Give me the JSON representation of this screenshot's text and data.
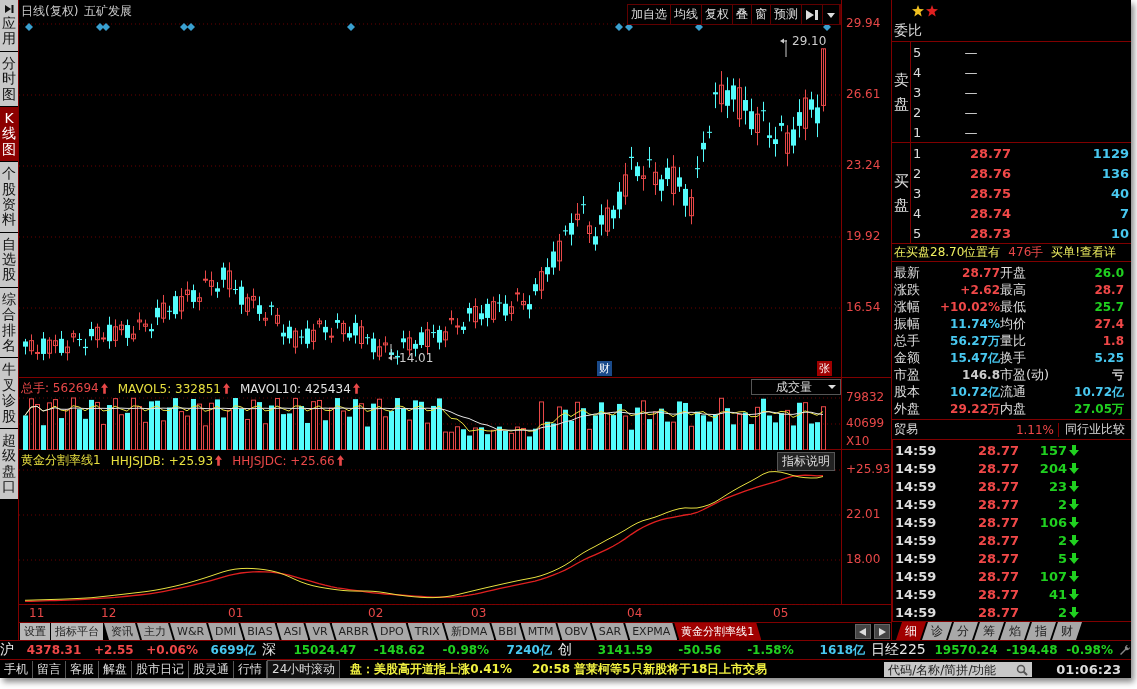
{
  "sidebar": [
    {
      "label": "应用",
      "kind": "app",
      "selected": false
    },
    {
      "label": "分时图",
      "kind": "view",
      "selected": false
    },
    {
      "label": "K线图",
      "kind": "view",
      "selected": true
    },
    {
      "label": "个股资料",
      "kind": "view",
      "selected": false
    },
    {
      "label": "自选股",
      "kind": "view",
      "selected": false
    },
    {
      "label": "综合排名",
      "kind": "view",
      "selected": false
    },
    {
      "label": "牛叉诊股",
      "kind": "view",
      "selected": false
    },
    {
      "label": "超级盘口",
      "kind": "view",
      "selected": false
    }
  ],
  "chart": {
    "title": "日线(复权)",
    "stock": "五矿发展",
    "toolbar": [
      "加自选",
      "均线",
      "复权",
      "叠",
      "窗",
      "预测"
    ],
    "price_axis": [
      "29.94",
      "26.61",
      "23.24",
      "19.92",
      "16.54"
    ],
    "high_mark": "29.10",
    "low_mark": "14.01",
    "badges": [
      {
        "text": "财",
        "kind": "finance"
      },
      {
        "text": "张",
        "kind": "limit"
      }
    ]
  },
  "volume": {
    "legend": [
      {
        "text": "总手: 562694",
        "color": "#e84848"
      },
      {
        "text": "MAVOL5: 332851",
        "color": "#e8e040"
      },
      {
        "text": "MAVOL10: 425434",
        "color": "#e4e4e4"
      }
    ],
    "selector": "成交量",
    "axis": [
      "79832",
      "40699",
      "X10"
    ]
  },
  "indicator": {
    "name": "黄金分割率线1",
    "legend": [
      {
        "text": "HHJSJDB: +25.93",
        "color": "#e8e040"
      },
      {
        "text": "HHJSJDC: +25.66",
        "color": "#e84848"
      }
    ],
    "help": "指标说明",
    "axis": [
      "+25.93",
      "22.01",
      "18.00"
    ]
  },
  "x_axis": [
    "11",
    "12",
    "01",
    "02",
    "03",
    "04",
    "05"
  ],
  "indicator_tabs": [
    {
      "label": "设置",
      "kind": "button",
      "selected": false
    },
    {
      "label": "指标平台",
      "kind": "button",
      "selected": false
    },
    {
      "label": "资讯",
      "kind": "tab",
      "selected": false
    },
    {
      "label": "主力",
      "kind": "tab",
      "selected": false
    },
    {
      "label": "W&R",
      "kind": "tab",
      "selected": false
    },
    {
      "label": "DMI",
      "kind": "tab",
      "selected": false
    },
    {
      "label": "BIAS",
      "kind": "tab",
      "selected": false
    },
    {
      "label": "ASI",
      "kind": "tab",
      "selected": false
    },
    {
      "label": "VR",
      "kind": "tab",
      "selected": false
    },
    {
      "label": "ARBR",
      "kind": "tab",
      "selected": false
    },
    {
      "label": "DPO",
      "kind": "tab",
      "selected": false
    },
    {
      "label": "TRIX",
      "kind": "tab",
      "selected": false
    },
    {
      "label": "新DMA",
      "kind": "tab",
      "selected": false
    },
    {
      "label": "BBI",
      "kind": "tab",
      "selected": false
    },
    {
      "label": "MTM",
      "kind": "tab",
      "selected": false
    },
    {
      "label": "OBV",
      "kind": "tab",
      "selected": false
    },
    {
      "label": "SAR",
      "kind": "tab",
      "selected": false
    },
    {
      "label": "EXPMA",
      "kind": "tab",
      "selected": false
    },
    {
      "label": "黄金分割率线1",
      "kind": "tab",
      "selected": true
    }
  ],
  "order_book": {
    "title": "委比",
    "sell_label": "卖盘",
    "buy_label": "买盘",
    "sell": [
      {
        "rank": "5",
        "price": "—"
      },
      {
        "rank": "4",
        "price": "—"
      },
      {
        "rank": "3",
        "price": "—"
      },
      {
        "rank": "2",
        "price": "—"
      },
      {
        "rank": "1",
        "price": "—"
      }
    ],
    "buy": [
      {
        "rank": "1",
        "price": "28.77",
        "volume": "1129"
      },
      {
        "rank": "2",
        "price": "28.76",
        "volume": "136"
      },
      {
        "rank": "3",
        "price": "28.75",
        "volume": "40"
      },
      {
        "rank": "4",
        "price": "28.74",
        "volume": "7"
      },
      {
        "rank": "5",
        "price": "28.73",
        "volume": "10"
      }
    ]
  },
  "notice": {
    "text": "在买盘28.70位置有",
    "qty": "476手",
    "link": "买单!查看详"
  },
  "stats": [
    [
      {
        "label": "最新",
        "value": "28.77",
        "color": "#f04848"
      },
      {
        "label": "开盘",
        "value": "26.0",
        "color": "#20d020"
      }
    ],
    [
      {
        "label": "涨跌",
        "value": "+2.62",
        "color": "#f04848"
      },
      {
        "label": "最高",
        "value": "28.7",
        "color": "#f04848"
      }
    ],
    [
      {
        "label": "涨幅",
        "value": "+10.02%",
        "color": "#f04848"
      },
      {
        "label": "最低",
        "value": "25.7",
        "color": "#20d020"
      }
    ],
    [
      {
        "label": "振幅",
        "value": "11.74%",
        "color": "#48c8f0"
      },
      {
        "label": "均价",
        "value": "27.4",
        "color": "#f04848"
      }
    ],
    [
      {
        "label": "总手",
        "value": "56.27万",
        "color": "#48c8f0"
      },
      {
        "label": "量比",
        "value": "1.8",
        "color": "#f04848"
      }
    ],
    [
      {
        "label": "金额",
        "value": "15.47亿",
        "color": "#48c8f0"
      },
      {
        "label": "换手",
        "value": "5.25",
        "color": "#48c8f0"
      }
    ],
    [
      {
        "label": "市盈",
        "value": "146.8",
        "color": "#cccccc"
      },
      {
        "label": "市盈(动)",
        "value": "亏",
        "color": "#cccccc"
      }
    ],
    [
      {
        "label": "股本",
        "value": "10.72亿",
        "color": "#48c8f0"
      },
      {
        "label": "流通",
        "value": "10.72亿",
        "color": "#48c8f0"
      }
    ],
    [
      {
        "label": "外盘",
        "value": "29.22万",
        "color": "#f04848"
      },
      {
        "label": "内盘",
        "value": "27.05万",
        "color": "#20d020"
      }
    ]
  ],
  "industry": {
    "name": "贸易",
    "change": "1.11%",
    "compare": "同行业比较"
  },
  "ticks": [
    {
      "time": "14:59",
      "price": "28.77",
      "volume": "157",
      "falling": true
    },
    {
      "time": "14:59",
      "price": "28.77",
      "volume": "204",
      "falling": true
    },
    {
      "time": "14:59",
      "price": "28.77",
      "volume": "23",
      "falling": true
    },
    {
      "time": "14:59",
      "price": "28.77",
      "volume": "2",
      "falling": true
    },
    {
      "time": "14:59",
      "price": "28.77",
      "volume": "106",
      "falling": true
    },
    {
      "time": "14:59",
      "price": "28.77",
      "volume": "2",
      "falling": true
    },
    {
      "time": "14:59",
      "price": "28.77",
      "volume": "5",
      "falling": true
    },
    {
      "time": "14:59",
      "price": "28.77",
      "volume": "107",
      "falling": true
    },
    {
      "time": "14:59",
      "price": "28.77",
      "volume": "41",
      "falling": true
    },
    {
      "time": "14:59",
      "price": "28.77",
      "volume": "2",
      "falling": true
    }
  ],
  "detail_tabs": [
    {
      "label": "细",
      "selected": true
    },
    {
      "label": "诊",
      "selected": false
    },
    {
      "label": "分",
      "selected": false
    },
    {
      "label": "筹",
      "selected": false
    },
    {
      "label": "焰",
      "selected": false
    },
    {
      "label": "指",
      "selected": false
    },
    {
      "label": "财",
      "selected": false
    }
  ],
  "index_bar": [
    {
      "name": "沪",
      "value": "4378.31",
      "change": "+2.55",
      "percent": "+0.06%",
      "amount": "6699亿",
      "color": "#f04848"
    },
    {
      "name": "深",
      "value": "15024.47",
      "change": "-148.62",
      "percent": "-0.98%",
      "amount": "7240亿",
      "color": "#20d020"
    },
    {
      "name": "创",
      "value": "3141.59",
      "change": "-50.56",
      "percent": "-1.58%",
      "amount": "1618亿",
      "color": "#20d020"
    },
    {
      "name": "日经225",
      "value": "19570.24",
      "change": "-194.48",
      "percent": "-0.98%",
      "color": "#20d020"
    }
  ],
  "status_bar": {
    "links": [
      "手机",
      "留言",
      "客服",
      "解盘",
      "股市日记",
      "股灵通",
      "行情",
      "24小时滚动"
    ],
    "news": [
      "盘：美股高开道指上涨0.41%",
      "20:58 普莱柯等5只新股将于18日上市交易"
    ],
    "search": {
      "placeholder": "代码/名称/简拼/功能"
    },
    "clock": "01:06:23"
  }
}
